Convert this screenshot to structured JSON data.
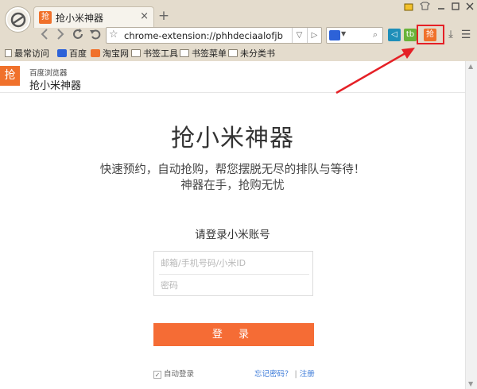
{
  "browser": {
    "tab": {
      "title": "抢小米神器",
      "favicon": "抢",
      "close": "×"
    },
    "new_tab": "+",
    "url": "chrome-extension://phhdeciaalofjbopjhfl",
    "nav_icons": [
      "back-icon",
      "forward-icon",
      "refresh-icon",
      "undo-icon"
    ],
    "bookmarks": [
      "最常访问",
      "百度",
      "淘宝网",
      "书签工具",
      "书签菜单",
      "未分类书"
    ],
    "extension_badge": "抢",
    "extension_badge_green": "tb",
    "colors": {
      "chrome_bg": "#e4dccd",
      "accent": "#f0712b",
      "highlight": "#e52026"
    }
  },
  "page": {
    "header": {
      "subtitle": "百度浏览器",
      "name": "抢小米神器",
      "logo": "抢"
    },
    "title": "抢小米神器",
    "slogan_line1": "快速预约，自动抢购，帮您摆脱无尽的排队与等待！",
    "slogan_line2": "神器在手，抢购无忧",
    "login_heading": "请登录小米账号",
    "account_placeholder": "邮箱/手机号码/小米ID",
    "password_placeholder": "密码",
    "login_button": "登 录",
    "auto_login": "自动登录",
    "forgot_password": "忘记密码？",
    "separator": "|",
    "register": "注册",
    "auto_login_checked": true
  }
}
